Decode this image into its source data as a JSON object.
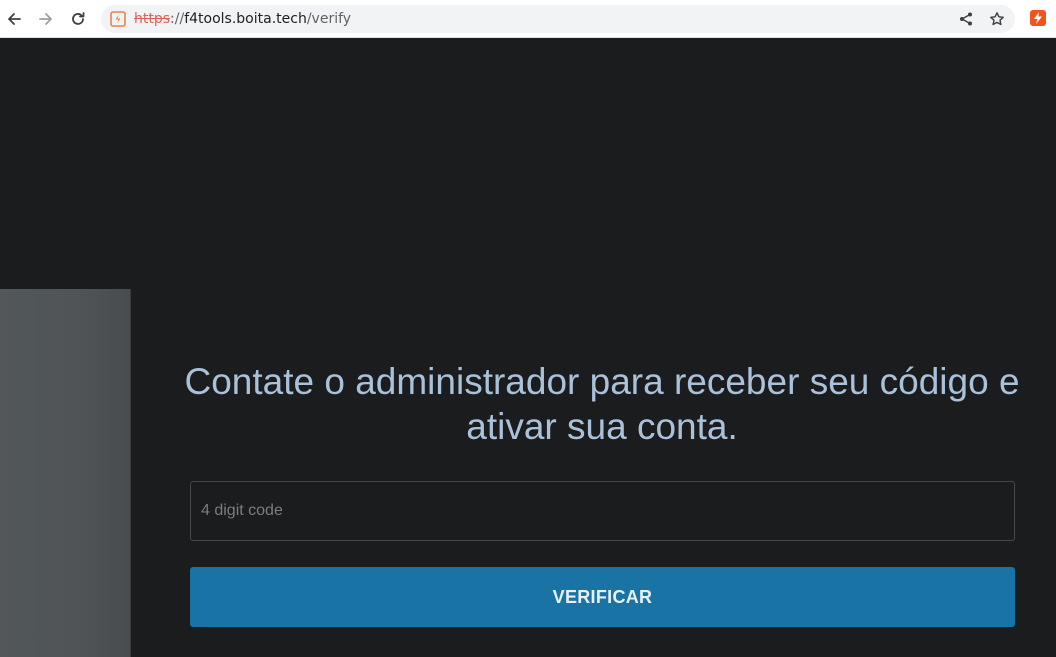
{
  "browser": {
    "url": {
      "scheme": "https",
      "separator": "://",
      "host": "f4tools.boita.tech",
      "path": "/verify"
    },
    "icons": {
      "back": "back-arrow-icon",
      "forward": "forward-arrow-icon",
      "reload": "reload-icon",
      "site_info": "not-secure-site-icon",
      "share": "share-icon",
      "bookmark": "star-icon",
      "extension": "extension-bolt-icon"
    },
    "colors": {
      "extension_accent": "#f2541b",
      "insecure_scheme": "#d93025"
    }
  },
  "verify_page": {
    "heading": "Contate o administrador para receber seu código e ativar sua conta.",
    "code_input": {
      "value": "",
      "placeholder": "4 digit code"
    },
    "submit_label": "VERIFICAR",
    "colors": {
      "background": "#1b1c1e",
      "heading": "#a9c1d9",
      "button": "#1a73a5"
    }
  }
}
